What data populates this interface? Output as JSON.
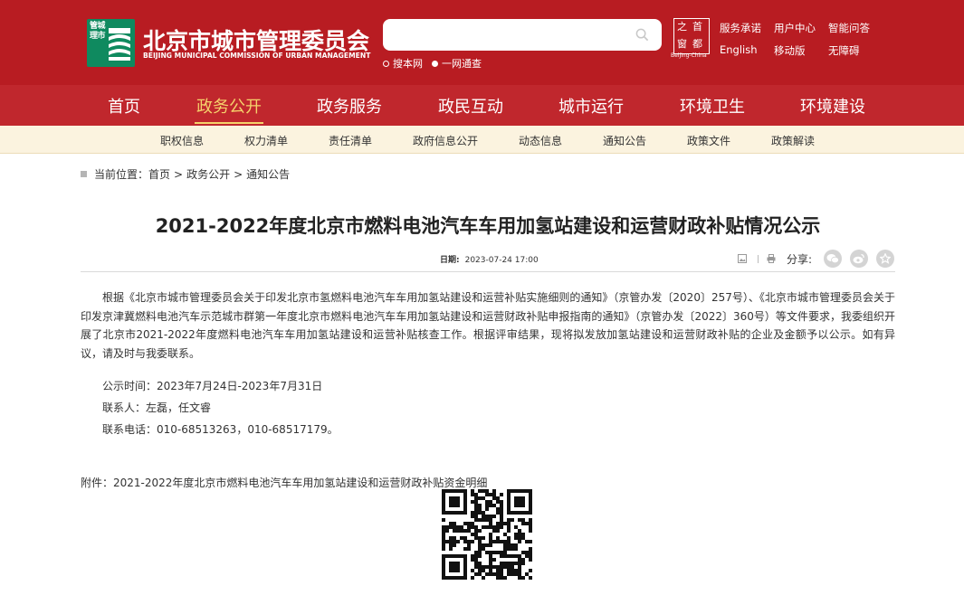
{
  "header": {
    "logo_badge_text": "管城理市",
    "site_name_cn": "北京市城市管理委员会",
    "site_name_en": "BEIJING MUNICIPAL COMMISSION OF URBAN MANAGEMENT",
    "search": {
      "placeholder": "",
      "scopes": [
        "搜本网",
        "一网通查"
      ]
    },
    "capital_logo": {
      "chars": [
        "之",
        "首",
        "窗",
        "都"
      ],
      "en": "Beijing-China"
    },
    "top_links": [
      "服务承诺",
      "用户中心",
      "智能问答",
      "English",
      "移动版",
      "无障碍"
    ]
  },
  "main_nav": {
    "items": [
      "首页",
      "政务公开",
      "政务服务",
      "政民互动",
      "城市运行",
      "环境卫生",
      "环境建设"
    ],
    "active": "政务公开"
  },
  "sub_nav": {
    "items": [
      "职权信息",
      "权力清单",
      "责任清单",
      "政府信息公开",
      "动态信息",
      "通知公告",
      "政策文件",
      "政策解读"
    ]
  },
  "breadcrumb": {
    "label": "当前位置：",
    "items": [
      "首页",
      "政务公开",
      "通知公告"
    ],
    "separator": ">"
  },
  "article": {
    "title": "2021-2022年度北京市燃料电池汽车车用加氢站建设和运营财政补贴情况公示",
    "date_label": "日期:",
    "date": "2023-07-24 17:00",
    "share_label": "分享:",
    "paragraph": "根据《北京市城市管理委员会关于印发北京市氢燃料电池汽车车用加氢站建设和运营补贴实施细则的通知》（京管办发〔2020〕257号）、《北京市城市管理委员会关于印发京津冀燃料电池汽车示范城市群第一年度北京市燃料电池汽车车用加氢站建设和运营财政补贴申报指南的通知》（京管办发〔2022〕360号）等文件要求，我委组织开展了北京市2021-2022年度燃料电池汽车车用加氢站建设和运营补贴核查工作。根据评审结果，现将拟发放加氢站建设和运营财政补贴的企业及金额予以公示。如有异议，请及时与我委联系。",
    "publicity_period": "公示时间：2023年7月24日-2023年7月31日",
    "contact": "联系人：左磊，任文睿",
    "phone": "联系电话：010-68513263，010-68517179。",
    "attachment": "附件：2021-2022年度北京市燃料电池汽车车用加氢站建设和运营财政补贴资金明细"
  },
  "colors": {
    "header_red": "#b81c22",
    "nav_red": "#c0272d",
    "active_gold": "#f5d26b",
    "subnav_bg": "#fbf3df",
    "logo_green": "#0f8a5f"
  }
}
